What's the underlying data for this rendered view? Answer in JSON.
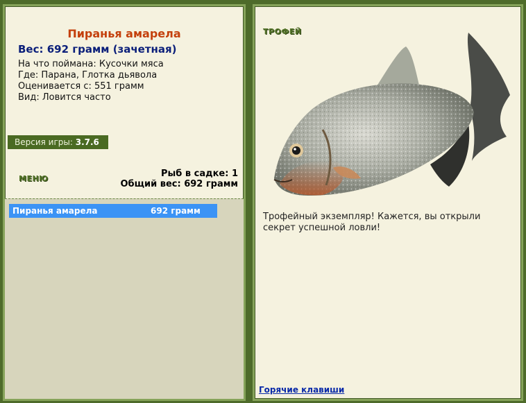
{
  "fish": {
    "name": "Пиранья амарела",
    "weight_line": "Вес: 692 грамм (зачетная)",
    "bait_line": "На что поймана: Кусочки мяса",
    "where_line": "Где: Парана, Глотка дьявола",
    "valued_line": "Оценивается с: 551 грамм",
    "kind_line": "Вид: Ловится часто"
  },
  "version": {
    "label": "Версия игры:",
    "value": "3.7.6"
  },
  "menu_label": "МЕНЮ",
  "stats": {
    "fish_count": "Рыб в садке: 1",
    "total_weight": "Общий вес: 692 грамм"
  },
  "catch_list": [
    {
      "name": "Пиранья амарела",
      "weight": "692 грамм"
    }
  ],
  "trophy": {
    "label": "ТРОФЕЙ",
    "text": "Трофейный экземпляр! Кажется, вы открыли секрет успешной ловли!"
  },
  "hotkeys_label": "Горячие клавиши",
  "colors": {
    "background": "#4e6b2a",
    "panel": "#f5f2df",
    "selected_row": "#3b93f5",
    "title": "#c4400c",
    "weight": "#0b1f7a"
  }
}
